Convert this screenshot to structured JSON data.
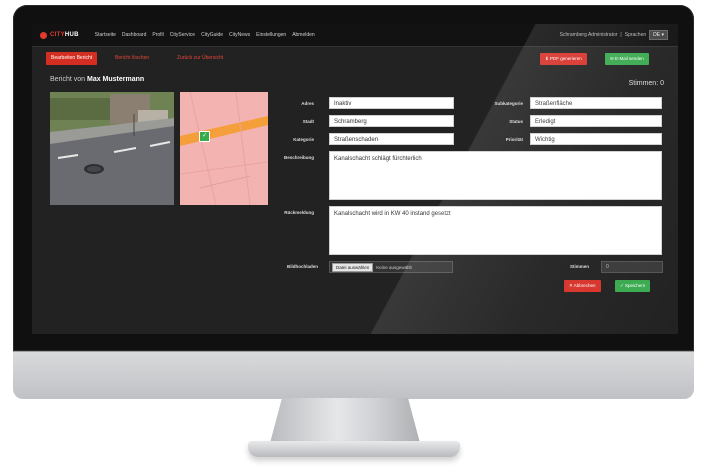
{
  "app": {
    "logo_prefix": "CITY",
    "logo_suffix": "HUB"
  },
  "nav": {
    "items": [
      "Startseite",
      "Dashboard",
      "Profil",
      "CityService",
      "CityGuide",
      "CityNews",
      "Einstellungen",
      "Abmelden"
    ],
    "user": "Schramberg Administrator",
    "separator": "|",
    "language_label": "Sprachen",
    "language_value": "DE"
  },
  "toolbar": {
    "tabs": [
      "Bearbeiten Bericht",
      "Bericht löschen",
      "Zurück zur Übersicht"
    ],
    "pdf_button": "PDF generieren",
    "email_button": "E-Mail senden"
  },
  "report": {
    "title_prefix": "Bericht von",
    "author": "Max Mustermann",
    "votes_label": "Stimmen:",
    "votes_value": "0"
  },
  "form": {
    "adress_label": "Adres",
    "adress_value": "Inaktiv",
    "subcategory_label": "Subkategorie",
    "subcategory_value": "Straßenfläche",
    "city_label": "Stadt",
    "city_value": "Schramberg",
    "status_label": "Status",
    "status_value": "Erledigt",
    "category_label": "Kategorie",
    "category_value": "Straßenschaden",
    "priority_label": "Priorität",
    "priority_value": "Wichtig",
    "description_label": "Beschreibung",
    "description_value": "Kanalschacht schlägt fürchterlich",
    "response_label": "Rückmeldung",
    "response_value": "Kanalschacht wird in KW 40 instand gesetzt",
    "image_upload_label": "Bildhochladen",
    "file_button": "Datei auswählen",
    "file_status": "Keine ausgewählt",
    "votes_input_label": "Stimmen",
    "votes_input_value": "0",
    "delete_button": "Abbrechen",
    "save_button": "Speichern"
  },
  "colors": {
    "accent_red": "#d7332b",
    "accent_green": "#3aaa4f",
    "screen_bg": "#222222"
  }
}
